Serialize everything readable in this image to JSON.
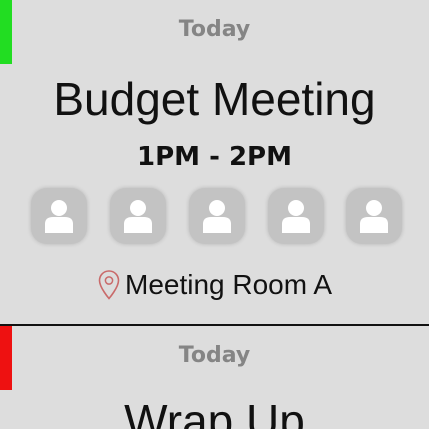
{
  "meetings": [
    {
      "day": "Today",
      "title": "Budget Meeting",
      "time": "1PM - 2PM",
      "status_color": "#22dd22",
      "attendee_count": 5,
      "location": "Meeting Room A"
    },
    {
      "day": "Today",
      "title": "Wrap Up",
      "status_color": "#ee1111"
    }
  ],
  "colors": {
    "background": "#dddddd",
    "divider": "#111111",
    "muted_text": "#858585",
    "avatar_bg": "#c3c3c3",
    "pin": "#c96a6a"
  },
  "icons": {
    "avatar": "user-silhouette-icon",
    "location": "map-pin-icon"
  }
}
